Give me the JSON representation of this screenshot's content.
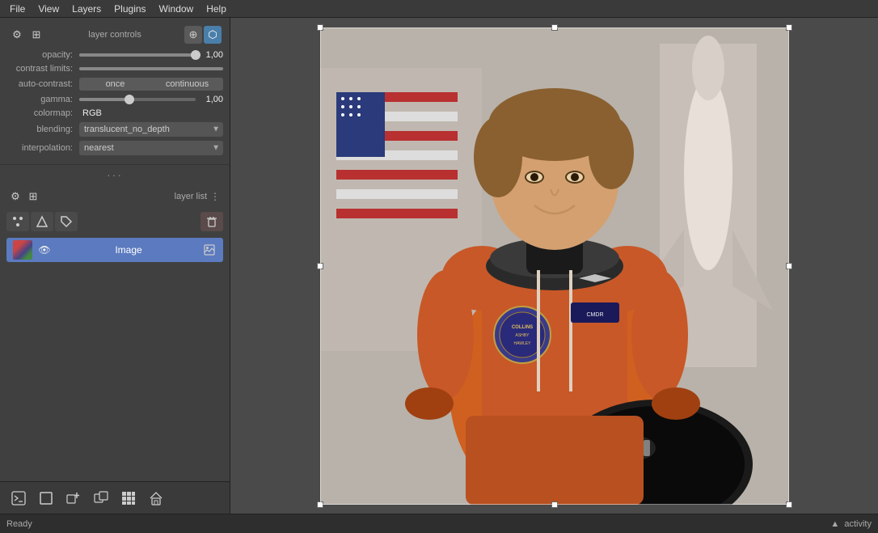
{
  "menubar": {
    "items": [
      "File",
      "View",
      "Layers",
      "Plugins",
      "Window",
      "Help"
    ]
  },
  "layer_controls": {
    "section_title": "layer controls",
    "opacity_label": "opacity:",
    "opacity_value": "1,00",
    "contrast_label": "contrast limits:",
    "auto_contrast_label": "auto-contrast:",
    "auto_once_label": "once",
    "auto_continuous_label": "continuous",
    "gamma_label": "gamma:",
    "gamma_value": "1,00",
    "colormap_label": "colormap:",
    "colormap_value": "RGB",
    "blending_label": "blending:",
    "blending_value": "translucent_no_depth",
    "interpolation_label": "interpolation:",
    "interpolation_value": "nearest"
  },
  "layer_list": {
    "section_title": "layer list",
    "image_layer_name": "Image"
  },
  "bottom_toolbar": {
    "buttons": [
      "terminal",
      "square",
      "cube-add",
      "cube-expand",
      "grid",
      "home"
    ]
  },
  "statusbar": {
    "ready_text": "Ready",
    "activity_text": "activity"
  }
}
